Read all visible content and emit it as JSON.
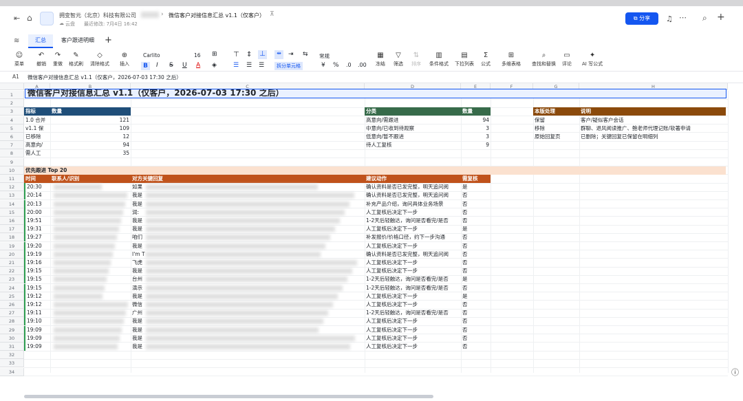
{
  "app": {
    "company": "拥变智元（北京）科技有限公司",
    "doc_title": "微信客户对接信息汇总 v1.1（仅客户）",
    "location": "云盘",
    "last_modified": "最近修改: 7月4日 16:42",
    "share_label": "分享"
  },
  "tabs": [
    {
      "label": "汇总",
      "active": true
    },
    {
      "label": "客户跟进明细",
      "active": false
    }
  ],
  "toolbar": {
    "menu": "菜单",
    "undo": "撤销",
    "redo": "重做",
    "format_painter": "格式刷",
    "clear_format": "清除格式",
    "insert": "插入",
    "font": "Carlito",
    "font_size": "16",
    "merge_cells": "拆分单元格",
    "number_format": "常规",
    "freeze": "冻结",
    "filter": "筛选",
    "sort": "排序",
    "cond_format": "条件格式",
    "dropdown": "下拉列表",
    "formula": "公式",
    "multi_table": "多维表格",
    "find_replace": "查找和替换",
    "comment": "评论",
    "ai_formula": "AI 写公式"
  },
  "formula_bar": {
    "cell_ref": "A1",
    "content": "微信客户对接信息汇总 v1.1（仅客户，2026-07-03 17:30 之后）"
  },
  "columns": [
    "A",
    "B",
    "C",
    "D",
    "E",
    "F",
    "G",
    "H"
  ],
  "rows": [
    "1",
    "2",
    "3",
    "4",
    "5",
    "6",
    "7",
    "8",
    "9",
    "10",
    "11",
    "12",
    "13",
    "14",
    "15",
    "16",
    "17",
    "18",
    "19",
    "20",
    "21",
    "22",
    "23",
    "24",
    "25",
    "26",
    "27",
    "28",
    "29",
    "30",
    "31",
    "32",
    "33",
    "34"
  ],
  "title": "微信客户对接信息汇总 v1.1（仅客户，2026-07-03 17:30 之后）",
  "summary": {
    "h1": "指标",
    "h2": "数量",
    "rows": [
      [
        "1.0 合并",
        "121"
      ],
      [
        "v1.1 保",
        "109"
      ],
      [
        "已移除",
        "12"
      ],
      [
        "高意向/",
        "94"
      ],
      [
        "需人工",
        "35"
      ]
    ]
  },
  "category": {
    "h1": "分类",
    "h2": "数量",
    "rows": [
      [
        "高意向/需跟进",
        "94"
      ],
      [
        "中意向/已收到待观察",
        "3"
      ],
      [
        "低意向/暂不跟进",
        "3"
      ],
      [
        "待人工复核",
        "9"
      ]
    ]
  },
  "version": {
    "h1": "本版处理",
    "h2": "说明",
    "rows": [
      [
        "保留",
        "客户/疑似客户会话"
      ],
      [
        "移除",
        "群聊、退风阅读推广、鲍老师代理记账/软著申请"
      ],
      [
        "原始回复页",
        "已删除；关键回复已保留在明细列"
      ]
    ]
  },
  "priority": {
    "title": "优先跟进 Top 20",
    "headers": [
      "时间",
      "联系人/识别",
      "对方关键回复",
      "建议动作",
      "需复核"
    ],
    "rows": [
      [
        "20:30",
        "如果",
        "确认资料是否已发完整，明天追问阅",
        "是"
      ],
      [
        "20:14",
        "我是",
        "确认资料是否已发完整，明天追问阅",
        "否"
      ],
      [
        "20:13",
        "我是",
        "补充产品介绍，询问具体业务场景",
        "否"
      ],
      [
        "20:00",
        "润:",
        "人工复核后决定下一步",
        "否"
      ],
      [
        "19:51",
        "我是",
        "1-2天后轻触达，询问是否看完/是否",
        "否"
      ],
      [
        "19:31",
        "我是",
        "人工复核后决定下一步",
        "是"
      ],
      [
        "19:27",
        "咱们",
        "补发报价/价格口径，约下一步沟通",
        "否"
      ],
      [
        "19:20",
        "我是",
        "人工复核后决定下一步",
        "否"
      ],
      [
        "19:19",
        "I'm T",
        "确认资料是否已发完整，明天追问阅",
        "否"
      ],
      [
        "19:16",
        "飞虎",
        "人工复核后决定下一步",
        "否"
      ],
      [
        "19:15",
        "我是",
        "人工复核后决定下一步",
        "否"
      ],
      [
        "19:15",
        "台州",
        "1-2天后轻触达，询问是否看完/是否",
        "是"
      ],
      [
        "19:15",
        "演示",
        "1-2天后轻触达，询问是否看完/是否",
        "否"
      ],
      [
        "19:12",
        "我是",
        "人工复核后决定下一步",
        "是"
      ],
      [
        "19:12",
        "微信",
        "人工复核后决定下一步",
        "否"
      ],
      [
        "19:11",
        "广州",
        "1-2天后轻触达，询问是否看完/是否",
        "否"
      ],
      [
        "19:10",
        "我是",
        "人工复核后决定下一步",
        "否"
      ],
      [
        "19:09",
        "我是",
        "人工复核后决定下一步",
        "否"
      ],
      [
        "19:09",
        "我是",
        "人工复核后决定下一步",
        "否"
      ],
      [
        "19:09",
        "我是",
        "人工复核后决定下一步",
        "否"
      ]
    ]
  },
  "colors": {
    "blue": "#1f4e79",
    "green": "#376b4a",
    "brown": "#8b4a0c",
    "orange": "#c0521b",
    "peach": "#fbe1cf",
    "accent": "#1456f0"
  }
}
